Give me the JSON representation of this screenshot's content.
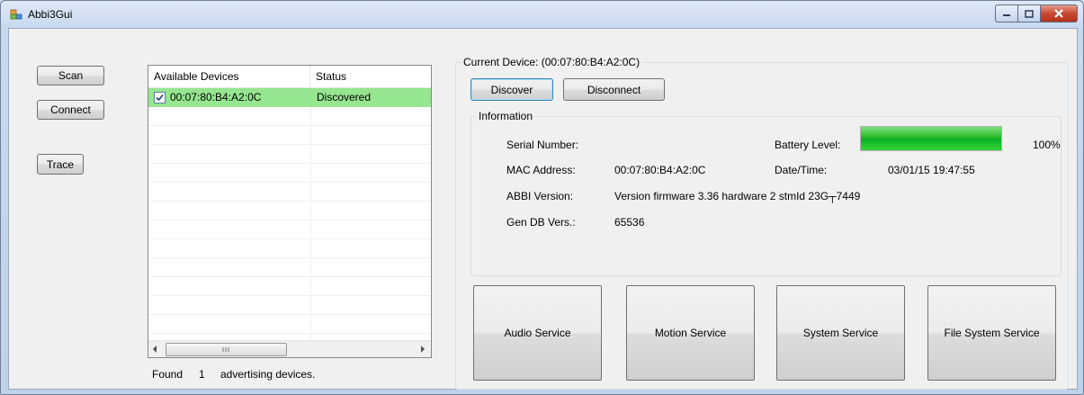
{
  "window": {
    "title": "Abbi3Gui"
  },
  "left_buttons": {
    "scan": "Scan",
    "connect": "Connect",
    "trace": "Trace"
  },
  "device_list": {
    "columns": [
      "Available Devices",
      "Status"
    ],
    "rows": [
      {
        "checked": true,
        "device": "00:07:80:B4:A2:0C",
        "status": "Discovered"
      }
    ]
  },
  "found": {
    "label": "Found",
    "count": "1",
    "suffix": "advertising devices."
  },
  "current_device": {
    "label": "Current Device: (00:07:80:B4:A2:0C)"
  },
  "device_buttons": {
    "discover": "Discover",
    "disconnect": "Disconnect"
  },
  "information": {
    "title": "Information",
    "serial_label": "Serial Number:",
    "serial_value": "",
    "mac_label": "MAC Address:",
    "mac_value": "00:07:80:B4:A2:0C",
    "abbi_label": "ABBI Version:",
    "abbi_value": "Version firmware 3.36 hardware 2 stmId 23G┬7449",
    "gendb_label": "Gen DB Vers.:",
    "gendb_value": "65536",
    "battery_label": "Battery Level:",
    "battery_percent_text": "100%",
    "battery_level": 1.0,
    "datetime_label": "Date/Time:",
    "datetime_value": "03/01/15 19:47:55"
  },
  "services": {
    "audio": "Audio Service",
    "motion": "Motion Service",
    "system": "System Service",
    "filesystem": "File System Service"
  },
  "colors": {
    "selected_row": "#96e590",
    "progress": "#06b025",
    "close_button": "#c64a33"
  },
  "icons": {
    "app": "app-window-icon",
    "minimize": "minimize-icon",
    "maximize": "maximize-icon",
    "close": "close-icon"
  }
}
